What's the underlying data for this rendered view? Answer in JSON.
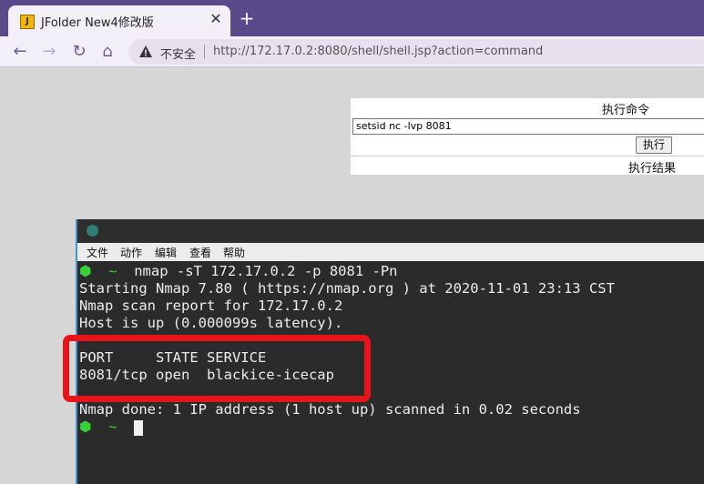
{
  "browser": {
    "tab": {
      "favicon": "jsp-icon",
      "title": "JFolder New4修改版",
      "close": "✕"
    },
    "new_tab": "+",
    "nav": {
      "back": "←",
      "forward": "→",
      "reload": "↻",
      "home": "⌂"
    },
    "security_label": "不安全",
    "url": "http://172.17.0.2:8080/shell/shell.jsp?action=command"
  },
  "page": {
    "exec_heading": "执行命令",
    "command_value": "setsid nc -lvp 8081",
    "exec_button": "执行",
    "result_heading": "执行结果"
  },
  "terminal": {
    "menu": [
      "文件",
      "动作",
      "编辑",
      "查看",
      "帮助"
    ],
    "lines": [
      {
        "prompt": "⬢  ~  ",
        "text": "nmap -sT 172.17.0.2 -p 8081 -Pn"
      },
      {
        "prompt": "",
        "text": "Starting Nmap 7.80 ( https://nmap.org ) at 2020-11-01 23:13 CST"
      },
      {
        "prompt": "",
        "text": "Nmap scan report for 172.17.0.2"
      },
      {
        "prompt": "",
        "text": "Host is up (0.000099s latency)."
      },
      {
        "prompt": "",
        "text": ""
      },
      {
        "prompt": "",
        "text": "PORT     STATE SERVICE"
      },
      {
        "prompt": "",
        "text": "8081/tcp open  blackice-icecap"
      },
      {
        "prompt": "",
        "text": ""
      },
      {
        "prompt": "",
        "text": "Nmap done: 1 IP address (1 host up) scanned in 0.02 seconds"
      },
      {
        "prompt": "⬢  ~  ",
        "text": ""
      }
    ]
  },
  "colors": {
    "highlight": "#e8141a",
    "prompt": "#38d238",
    "tabbar": "#5a4a8c"
  }
}
